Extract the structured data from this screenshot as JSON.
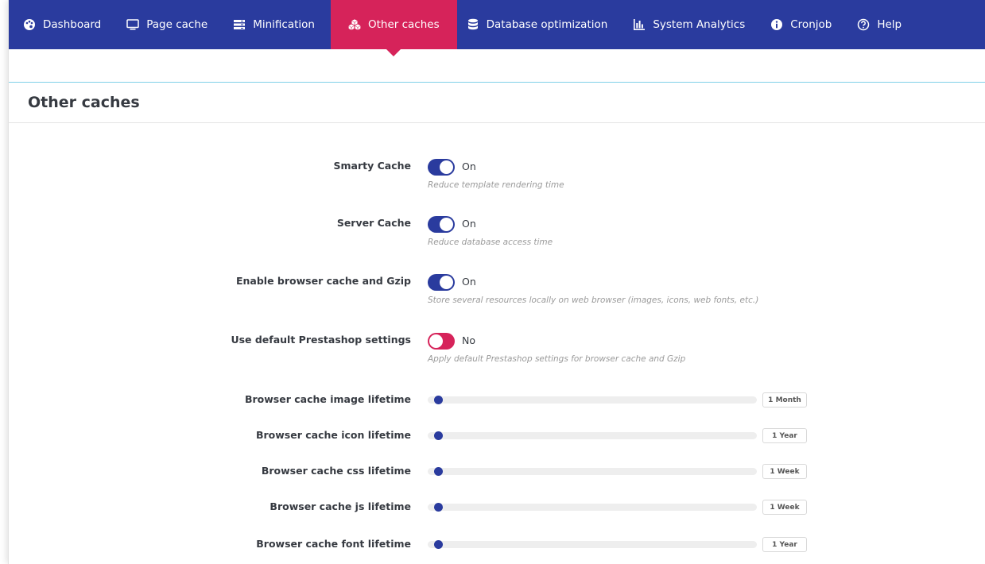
{
  "nav": {
    "items": [
      {
        "label": "Dashboard",
        "icon": "palette-icon"
      },
      {
        "label": "Page cache",
        "icon": "monitor-icon"
      },
      {
        "label": "Minification",
        "icon": "server-icon"
      },
      {
        "label": "Other caches",
        "icon": "cubes-icon",
        "active": true
      },
      {
        "label": "Database optimization",
        "icon": "database-icon"
      },
      {
        "label": "System Analytics",
        "icon": "bar-chart-icon"
      },
      {
        "label": "Cronjob",
        "icon": "info-circle-icon"
      },
      {
        "label": "Help",
        "icon": "question-circle-icon"
      }
    ]
  },
  "colors": {
    "primary": "#2a3b9e",
    "accent": "#d6235a",
    "divider": "#7fd0e8"
  },
  "panel": {
    "title": "Other caches"
  },
  "toggles": [
    {
      "label": "Smarty Cache",
      "state": "On",
      "on": true,
      "hint": "Reduce template rendering time"
    },
    {
      "label": "Server Cache",
      "state": "On",
      "on": true,
      "hint": "Reduce database access time"
    },
    {
      "label": "Enable browser cache and Gzip",
      "state": "On",
      "on": true,
      "hint": "Store several resources locally on web browser (images, icons, web fonts, etc.)"
    },
    {
      "label": "Use default Prestashop settings",
      "state": "No",
      "on": false,
      "hint": "Apply default Prestashop settings for browser cache and Gzip"
    }
  ],
  "sliders": [
    {
      "label": "Browser cache image lifetime",
      "value": "1 Month",
      "position": 0.0
    },
    {
      "label": "Browser cache icon lifetime",
      "value": "1 Year",
      "position": 0.0
    },
    {
      "label": "Browser cache css lifetime",
      "value": "1 Week",
      "position": 0.0
    },
    {
      "label": "Browser cache js lifetime",
      "value": "1 Week",
      "position": 0.0
    },
    {
      "label": "Browser cache font lifetime",
      "value": "1 Year",
      "position": 0.0
    }
  ]
}
